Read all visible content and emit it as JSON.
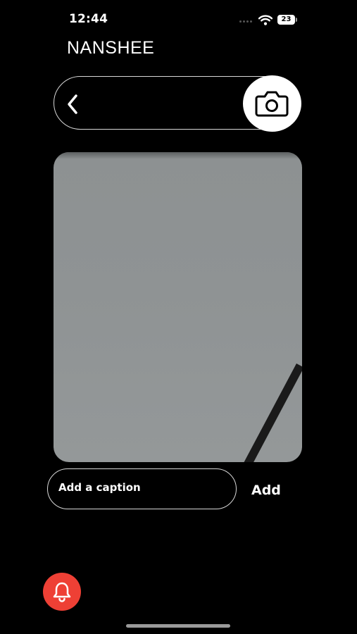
{
  "status_bar": {
    "time": "12:44",
    "battery_level": "23",
    "signal_icon": "cellular-dots-icon",
    "wifi_icon": "wifi-icon",
    "battery_icon": "battery-icon"
  },
  "header": {
    "brand": "NANSHEE"
  },
  "search_bar": {
    "back_icon": "chevron-left-icon",
    "camera_icon": "camera-icon"
  },
  "preview": {
    "kind": "camera-photo-preview",
    "dominant_color": "#8f9394"
  },
  "caption": {
    "placeholder": "Add a caption",
    "add_label": "Add"
  },
  "fab": {
    "icon": "bell-icon",
    "color": "#ee4035"
  },
  "colors": {
    "background": "#000000",
    "foreground": "#ffffff",
    "accent": "#ee4035"
  }
}
